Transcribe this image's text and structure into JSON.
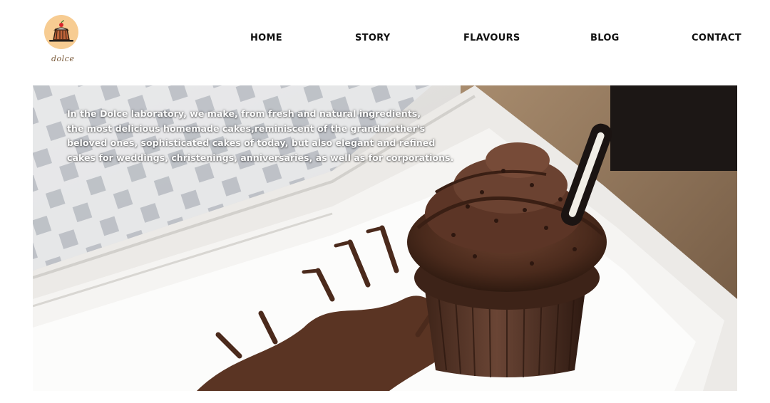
{
  "brand": {
    "logo_text": "dolce",
    "logo_icon": "pudding-icon",
    "logo_color": "#f7cc92"
  },
  "nav": {
    "items": [
      {
        "label": "HOME"
      },
      {
        "label": "STORY"
      },
      {
        "label": "FLAVOURS"
      },
      {
        "label": "BLOG"
      },
      {
        "label": "CONTACT"
      }
    ]
  },
  "hero": {
    "text": "In the Dolce laboratory, we make, from fresh and natural ingredients,\nthe most delicious homemade cakes,reminiscent of the grandmother's\nbeloved ones, sophisticated cakes of today, but also elegant and refined\ncakes for weddings, christenings, anniversaries, as well as for corporations.",
    "image": "chocolate-cupcake-photo"
  }
}
